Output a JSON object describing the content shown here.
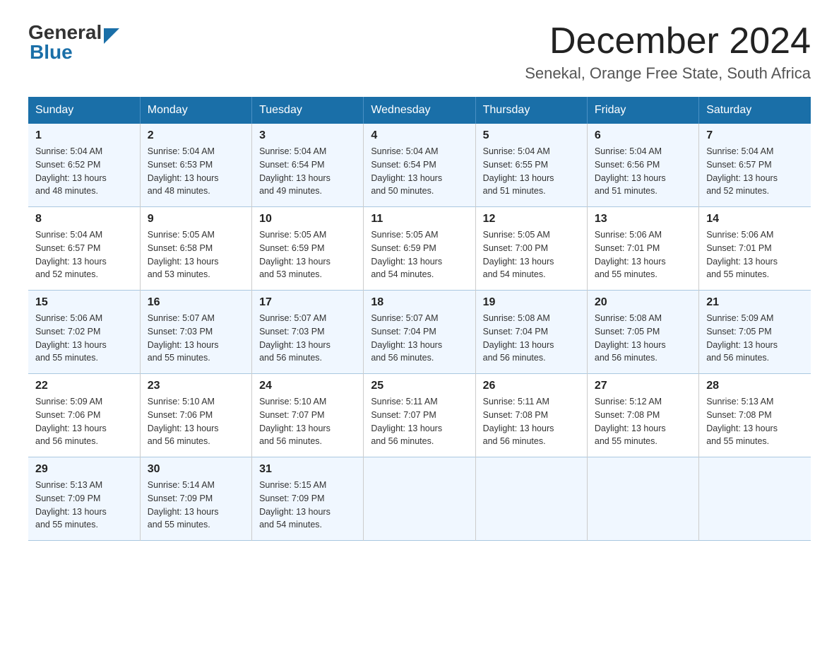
{
  "header": {
    "logo_general": "General",
    "logo_blue": "Blue",
    "month_title": "December 2024",
    "location": "Senekal, Orange Free State, South Africa"
  },
  "days_of_week": [
    "Sunday",
    "Monday",
    "Tuesday",
    "Wednesday",
    "Thursday",
    "Friday",
    "Saturday"
  ],
  "weeks": [
    [
      {
        "day": "1",
        "sunrise": "5:04 AM",
        "sunset": "6:52 PM",
        "daylight": "13 hours and 48 minutes."
      },
      {
        "day": "2",
        "sunrise": "5:04 AM",
        "sunset": "6:53 PM",
        "daylight": "13 hours and 48 minutes."
      },
      {
        "day": "3",
        "sunrise": "5:04 AM",
        "sunset": "6:54 PM",
        "daylight": "13 hours and 49 minutes."
      },
      {
        "day": "4",
        "sunrise": "5:04 AM",
        "sunset": "6:54 PM",
        "daylight": "13 hours and 50 minutes."
      },
      {
        "day": "5",
        "sunrise": "5:04 AM",
        "sunset": "6:55 PM",
        "daylight": "13 hours and 51 minutes."
      },
      {
        "day": "6",
        "sunrise": "5:04 AM",
        "sunset": "6:56 PM",
        "daylight": "13 hours and 51 minutes."
      },
      {
        "day": "7",
        "sunrise": "5:04 AM",
        "sunset": "6:57 PM",
        "daylight": "13 hours and 52 minutes."
      }
    ],
    [
      {
        "day": "8",
        "sunrise": "5:04 AM",
        "sunset": "6:57 PM",
        "daylight": "13 hours and 52 minutes."
      },
      {
        "day": "9",
        "sunrise": "5:05 AM",
        "sunset": "6:58 PM",
        "daylight": "13 hours and 53 minutes."
      },
      {
        "day": "10",
        "sunrise": "5:05 AM",
        "sunset": "6:59 PM",
        "daylight": "13 hours and 53 minutes."
      },
      {
        "day": "11",
        "sunrise": "5:05 AM",
        "sunset": "6:59 PM",
        "daylight": "13 hours and 54 minutes."
      },
      {
        "day": "12",
        "sunrise": "5:05 AM",
        "sunset": "7:00 PM",
        "daylight": "13 hours and 54 minutes."
      },
      {
        "day": "13",
        "sunrise": "5:06 AM",
        "sunset": "7:01 PM",
        "daylight": "13 hours and 55 minutes."
      },
      {
        "day": "14",
        "sunrise": "5:06 AM",
        "sunset": "7:01 PM",
        "daylight": "13 hours and 55 minutes."
      }
    ],
    [
      {
        "day": "15",
        "sunrise": "5:06 AM",
        "sunset": "7:02 PM",
        "daylight": "13 hours and 55 minutes."
      },
      {
        "day": "16",
        "sunrise": "5:07 AM",
        "sunset": "7:03 PM",
        "daylight": "13 hours and 55 minutes."
      },
      {
        "day": "17",
        "sunrise": "5:07 AM",
        "sunset": "7:03 PM",
        "daylight": "13 hours and 56 minutes."
      },
      {
        "day": "18",
        "sunrise": "5:07 AM",
        "sunset": "7:04 PM",
        "daylight": "13 hours and 56 minutes."
      },
      {
        "day": "19",
        "sunrise": "5:08 AM",
        "sunset": "7:04 PM",
        "daylight": "13 hours and 56 minutes."
      },
      {
        "day": "20",
        "sunrise": "5:08 AM",
        "sunset": "7:05 PM",
        "daylight": "13 hours and 56 minutes."
      },
      {
        "day": "21",
        "sunrise": "5:09 AM",
        "sunset": "7:05 PM",
        "daylight": "13 hours and 56 minutes."
      }
    ],
    [
      {
        "day": "22",
        "sunrise": "5:09 AM",
        "sunset": "7:06 PM",
        "daylight": "13 hours and 56 minutes."
      },
      {
        "day": "23",
        "sunrise": "5:10 AM",
        "sunset": "7:06 PM",
        "daylight": "13 hours and 56 minutes."
      },
      {
        "day": "24",
        "sunrise": "5:10 AM",
        "sunset": "7:07 PM",
        "daylight": "13 hours and 56 minutes."
      },
      {
        "day": "25",
        "sunrise": "5:11 AM",
        "sunset": "7:07 PM",
        "daylight": "13 hours and 56 minutes."
      },
      {
        "day": "26",
        "sunrise": "5:11 AM",
        "sunset": "7:08 PM",
        "daylight": "13 hours and 56 minutes."
      },
      {
        "day": "27",
        "sunrise": "5:12 AM",
        "sunset": "7:08 PM",
        "daylight": "13 hours and 55 minutes."
      },
      {
        "day": "28",
        "sunrise": "5:13 AM",
        "sunset": "7:08 PM",
        "daylight": "13 hours and 55 minutes."
      }
    ],
    [
      {
        "day": "29",
        "sunrise": "5:13 AM",
        "sunset": "7:09 PM",
        "daylight": "13 hours and 55 minutes."
      },
      {
        "day": "30",
        "sunrise": "5:14 AM",
        "sunset": "7:09 PM",
        "daylight": "13 hours and 55 minutes."
      },
      {
        "day": "31",
        "sunrise": "5:15 AM",
        "sunset": "7:09 PM",
        "daylight": "13 hours and 54 minutes."
      },
      null,
      null,
      null,
      null
    ]
  ],
  "labels": {
    "sunrise": "Sunrise:",
    "sunset": "Sunset:",
    "daylight": "Daylight:"
  }
}
